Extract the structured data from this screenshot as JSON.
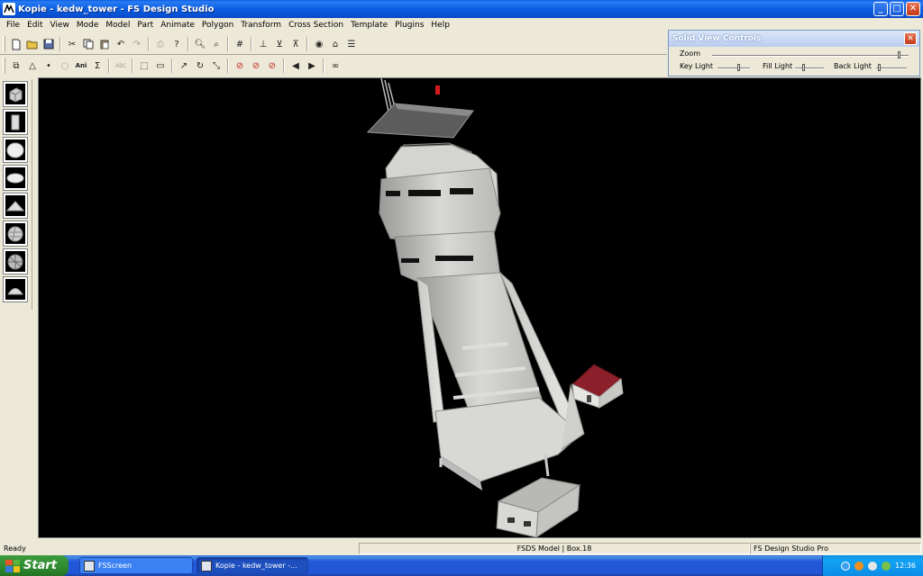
{
  "window": {
    "title": "Kopie - kedw_tower - FS Design Studio",
    "app_icon": "fsds-app-icon",
    "buttons": {
      "minimize": "_",
      "maximize": "□",
      "close": "✕"
    }
  },
  "menu": {
    "items": [
      "File",
      "Edit",
      "View",
      "Mode",
      "Model",
      "Part",
      "Animate",
      "Polygon",
      "Transform",
      "Cross Section",
      "Template",
      "Plugins",
      "Help"
    ]
  },
  "toolbar1": {
    "icons": [
      "new-icon",
      "open-icon",
      "save-icon",
      "cut-icon",
      "copy-icon",
      "paste-icon",
      "undo-icon",
      "redo-icon",
      "print-icon",
      "help-icon",
      "zoom-in-icon",
      "zoom-out-icon",
      "grid-icon",
      "align-x-icon",
      "align-y-icon",
      "align-z-icon",
      "view-icon",
      "home-icon",
      "settings-icon"
    ]
  },
  "toolbar2": {
    "ani_label": "Ani",
    "icons": [
      "select-icon",
      "triangle-icon",
      "point-icon",
      "circle-icon",
      "ani-icon",
      "sigma-icon",
      "abc-icon",
      "marquee-icon",
      "ruler-icon",
      "arrow-icon",
      "rotate-icon",
      "scale-icon",
      "no-entry-icon",
      "no-entry-icon",
      "no-entry-icon",
      "prev-icon",
      "next-icon",
      "binoculars-icon"
    ]
  },
  "solid_view": {
    "title": "Solid View Controls",
    "zoom_label": "Zoom",
    "key_light_label": "Key Light",
    "fill_light_label": "Fill Light",
    "back_light_label": "Back Light"
  },
  "palette": {
    "items": [
      "cube-shape-icon",
      "cylinder-shape-icon",
      "sphere-shape-icon",
      "disc-shape-icon",
      "cone-shape-icon",
      "geosphere-shape-icon",
      "textured-sphere-icon",
      "dome-shape-icon"
    ]
  },
  "statusbar": {
    "ready": "Ready",
    "model_info": "FSDS Model | Box.18",
    "product": "FS Design Studio Pro"
  },
  "taskbar": {
    "start_label": "Start",
    "tasks": [
      {
        "label": "FSScreen",
        "active": false
      },
      {
        "label": "Kopie - kedw_tower -...",
        "active": true
      }
    ],
    "lang": "CS",
    "clock": "12:36"
  },
  "colors": {
    "title_blue": "#0a5ee0",
    "face": "#ece9d8",
    "viewport_bg": "#000000",
    "roof_red": "#8b1f2a"
  }
}
